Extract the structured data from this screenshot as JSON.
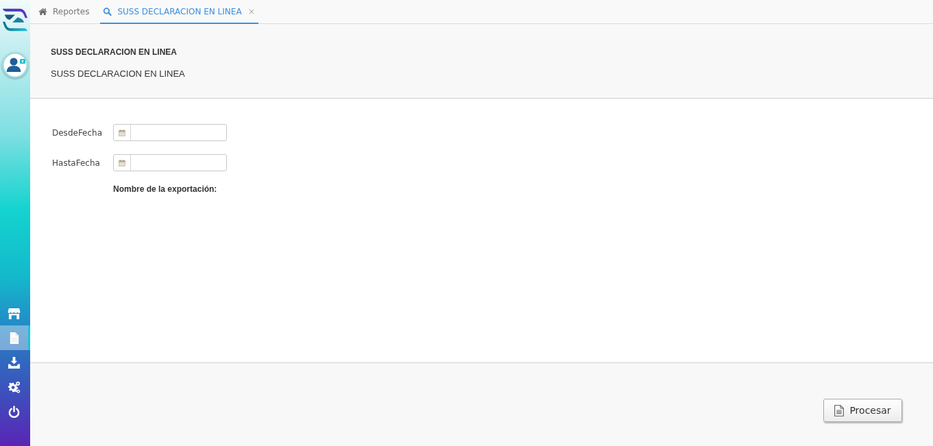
{
  "sidebar": {
    "nav_items": [
      {
        "selected": false
      },
      {
        "selected": true
      },
      {
        "selected": false
      },
      {
        "selected": false
      },
      {
        "selected": false
      }
    ]
  },
  "tabs": [
    {
      "label": "Reportes",
      "selected": false,
      "closable": false
    },
    {
      "label": "SUSS DECLARACION EN LINEA",
      "selected": true,
      "closable": true
    }
  ],
  "header": {
    "title": "SUSS DECLARACION EN LINEA",
    "subtitle": "SUSS DECLARACION EN LINEA"
  },
  "form": {
    "fields": [
      {
        "label": "DesdeFecha"
      },
      {
        "label": "HastaFecha"
      }
    ],
    "export_label": "Nombre de la exportación:"
  },
  "footer": {
    "button": "Procesar"
  }
}
